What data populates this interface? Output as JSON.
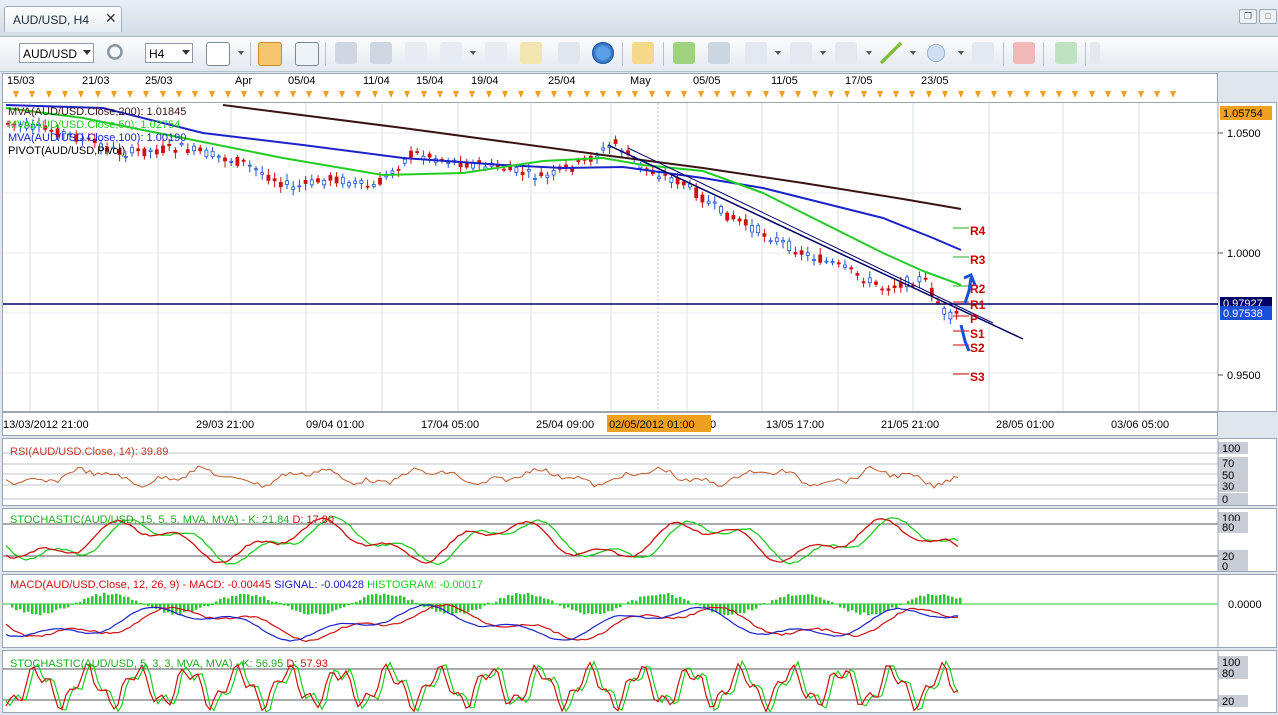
{
  "tab": {
    "title": "AUD/USD, H4",
    "close": "✕"
  },
  "toolbar": {
    "symbol": "AUD/USD",
    "timeframe": "H4"
  },
  "top_dates": [
    "15/03",
    "21/03",
    "25/03",
    "Apr",
    "05/04",
    "11/04",
    "15/04",
    "19/04",
    "25/04",
    "May",
    "05/05",
    "11/05",
    "17/05",
    "23/05"
  ],
  "main_legend": {
    "mva200": "MVA(AUD/USD.Close,200): 1.01845",
    "mva50": "MVA(AUD/USD.Close,50): 1.02754",
    "mva100": "MVA(AUD/USD.Close,100): 1.00190",
    "pivot": "PIVOT(AUD/USD,Pivot)"
  },
  "price_scale": [
    "1.0500",
    "1.0000",
    "0.9500"
  ],
  "price_tags": {
    "high": "1.05754",
    "hline": "0.97927",
    "last": "0.97538"
  },
  "pivot_levels": [
    "R4",
    "R3",
    "R2",
    "R1",
    "P",
    "S1",
    "S2",
    "S3"
  ],
  "bottom_dates": [
    "13/03/2012 21:00",
    "29/03 21:00",
    "09/04 01:00",
    "17/04 05:00",
    "25/04 09:00",
    "0",
    "13/05 17:00",
    "21/05 21:00",
    "28/05 01:00",
    "03/06 05:00"
  ],
  "cursor_date": "02/05/2012 01:00",
  "rsi": {
    "label": "RSI(AUD/USD.Close, 14): 39.89",
    "scale": [
      "100",
      "70",
      "50",
      "30",
      "0"
    ]
  },
  "stoch1": {
    "label": "STOCHASTIC(AUD/USD, 15, 5, 5, MVA, MVA) -",
    "k": "K: 21.84",
    "d": "D: 17.80",
    "scale": [
      "100",
      "80",
      "20",
      "0"
    ]
  },
  "macd": {
    "label": "MACD(AUD/USD.Close, 12, 26, 9) -",
    "macd": "MACD: -0.00445",
    "signal": "SIGNAL: -0.00428",
    "hist": "HISTOGRAM: -0.00017",
    "scale": [
      "0.0000"
    ]
  },
  "stoch2": {
    "label": "STOCHASTIC(AUD/USD, 5, 3, 3, MVA, MVA) -",
    "k": "K: 56.95",
    "d": "D: 57.93",
    "scale": [
      "100",
      "80",
      "20"
    ]
  },
  "colors": {
    "bull": "#1a4fd6",
    "bear": "#cc1111",
    "mva50": "#22cc22",
    "mva100": "#1a22c8",
    "mva200": "#3a1414",
    "hline": "#000066",
    "pivot": "#cc0000"
  }
}
